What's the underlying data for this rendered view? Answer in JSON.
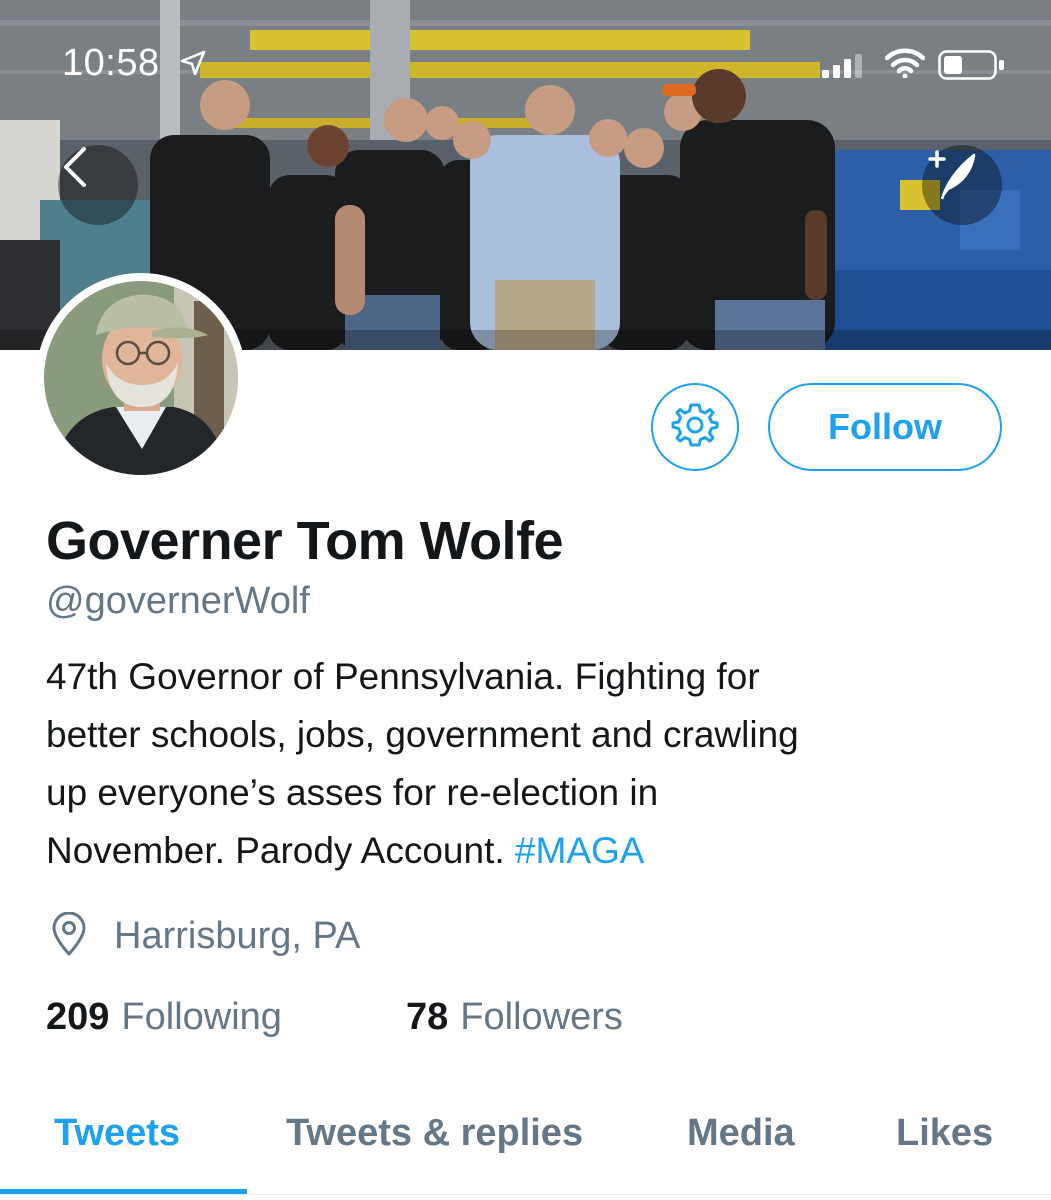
{
  "status_bar": {
    "time": "10:58",
    "location_arrow_icon": "location-arrow-icon",
    "signal_icon": "cellular-signal-icon",
    "wifi_icon": "wifi-icon",
    "battery_icon": "battery-icon"
  },
  "header": {
    "banner_icon": "factory-group-photo",
    "back_icon": "chevron-left-icon",
    "compose_icon": "compose-tweet-icon"
  },
  "profile": {
    "avatar_icon": "profile-photo",
    "settings_icon": "gear-icon",
    "follow_label": "Follow",
    "display_name": "Governer Tom Wolfe",
    "handle": "@governerWolf",
    "bio_lines": [
      "47th Governor of Pennsylvania. Fighting for",
      "better schools, jobs, government and crawling",
      "up everyone’s asses for re-election in",
      "November. Parody Account. "
    ],
    "bio_hashtag": "#MAGA",
    "location_icon": "map-pin-icon",
    "location": "Harrisburg, PA",
    "following_count": "209",
    "following_label": "Following",
    "followers_count": "78",
    "followers_label": "Followers"
  },
  "tabs": [
    {
      "label": "Tweets",
      "active": true
    },
    {
      "label": "Tweets & replies",
      "active": false
    },
    {
      "label": "Media",
      "active": false
    },
    {
      "label": "Likes",
      "active": false
    }
  ],
  "colors": {
    "accent": "#1da1f2",
    "secondary_text": "#657786",
    "primary_text": "#14171a"
  }
}
